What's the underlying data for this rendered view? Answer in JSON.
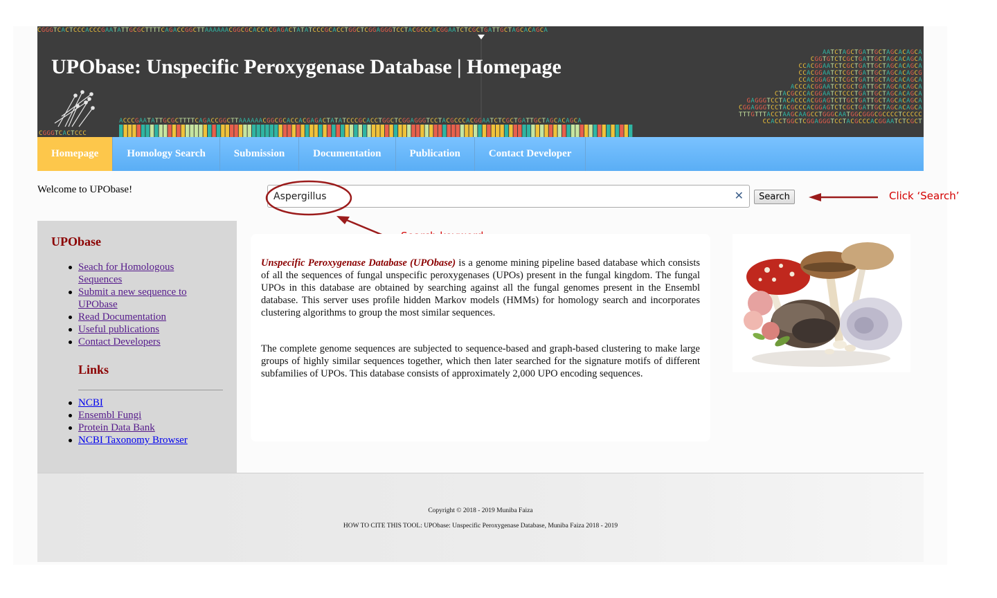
{
  "banner": {
    "title": "UPObase: Unspecific Peroxygenase Database | Homepage",
    "sequence_text": "CGGGTCACTCCCACCCGAATATTGCGCTTTTCAGACCGGCTTAAAAAACGGCGCACCACGAGACTATATCCCGCACCTGGCTCGGAGGGTCCTACGCCCACGGAATCTCGCTGATTGCTAGCACAGCA",
    "logo_text": "CGGGTCACTCCC",
    "track_text": "ACCCGAATATTGCGCTTTTCAGACCGGCTTAAAAAACGGCGCACCACGAGACTATATCCCGCACCTGGCTCGGAGGGTCCTACGCCCACGGAATCTCGCTGATTGCTAGCACAGCA",
    "stack_rows": [
      "AATCTAGCTGATTGCTAGCACAGCA",
      "CGGTGTCTCGCTGATTGCTAGCACAGCA",
      "CCACGGAATCTCGCTGATTGCTAGCACAGCA",
      "CCACGGAATCTCGCTGATTGCTAGCACAGCG",
      "CCACGGAGTCTCGCTGATTGCTAGCACAGCA",
      "ACCCACGGAATCTCGCTGATTGCTAGCACAGCA",
      "CTACGCCCACGGAATCTCCCTGATTGCTAGCACAGCA",
      "GAGGGTCCTACACCCACGGAGTCTTGCTGATTGCTAGCACAGCA",
      "CGGAGGGTCCTACGCCCACGGAGTCTCGCTGATTGCTAGCACAGCA",
      "TTTGTTTACCTAAGCAAGCCTGGGCAATGGCGGGCGCCCCTCCCCC",
      "CCACCTGGCTCGGAGGGTCCTACGCCCACGGAATCTCGCT"
    ],
    "colors": {
      "bg": "#3d3d3d",
      "a": "#2fb5a3",
      "c": "#f0c23a",
      "g": "#e8604c",
      "t": "#c6e5a0"
    }
  },
  "nav": [
    {
      "label": "Homepage",
      "active": true
    },
    {
      "label": "Homology Search"
    },
    {
      "label": "Submission"
    },
    {
      "label": "Documentation"
    },
    {
      "label": "Publication"
    },
    {
      "label": "Contact Developer"
    }
  ],
  "welcome": "Welcome to UPObase!",
  "search": {
    "value": "Aspergillus",
    "button": "Search",
    "clear_icon": "close-icon"
  },
  "annotations": {
    "click_search": "Click ‘Search’",
    "search_keyword": "Search keyword"
  },
  "sidebar": {
    "title": "UPObase",
    "items": [
      "Seach for Homologous Sequences",
      "Submit a new sequence to UPObase",
      "Read Documentation",
      "Useful publications",
      "Contact Developers"
    ],
    "links_title": "Links",
    "links": [
      "NCBI",
      "Ensembl Fungi",
      "Protein Data Bank",
      "NCBI Taxonomy Browser"
    ]
  },
  "content": {
    "para1_em": "Unspecific Peroxygenase Database (UPObase)",
    "para1_rest": " is a genome mining pipeline based database which consists of all the sequences of fungal unspecific peroxygenases (UPOs) present in the fungal kingdom. The fungal UPOs in this database are obtained by searching against all the fungal genomes present in the Ensembl database. This server uses profile hidden Markov models (HMMs) for homology search and incorporates clustering algorithms to group the most similar sequences.",
    "para2": "The complete genome sequences are subjected to sequence-based and graph-based clustering to make large groups of highly similar sequences together, which then later searched for the signature motifs of different subfamilies of UPOs. This database consists of approximately 2,000 UPO encoding sequences."
  },
  "footer": {
    "copyright": "Copyright © 2018 - 2019 Muniba Faiza",
    "cite": "HOW TO CITE THIS TOOL: UPObase: Unspecific Peroxygenase Database, Muniba Faiza 2018 - 2019"
  }
}
